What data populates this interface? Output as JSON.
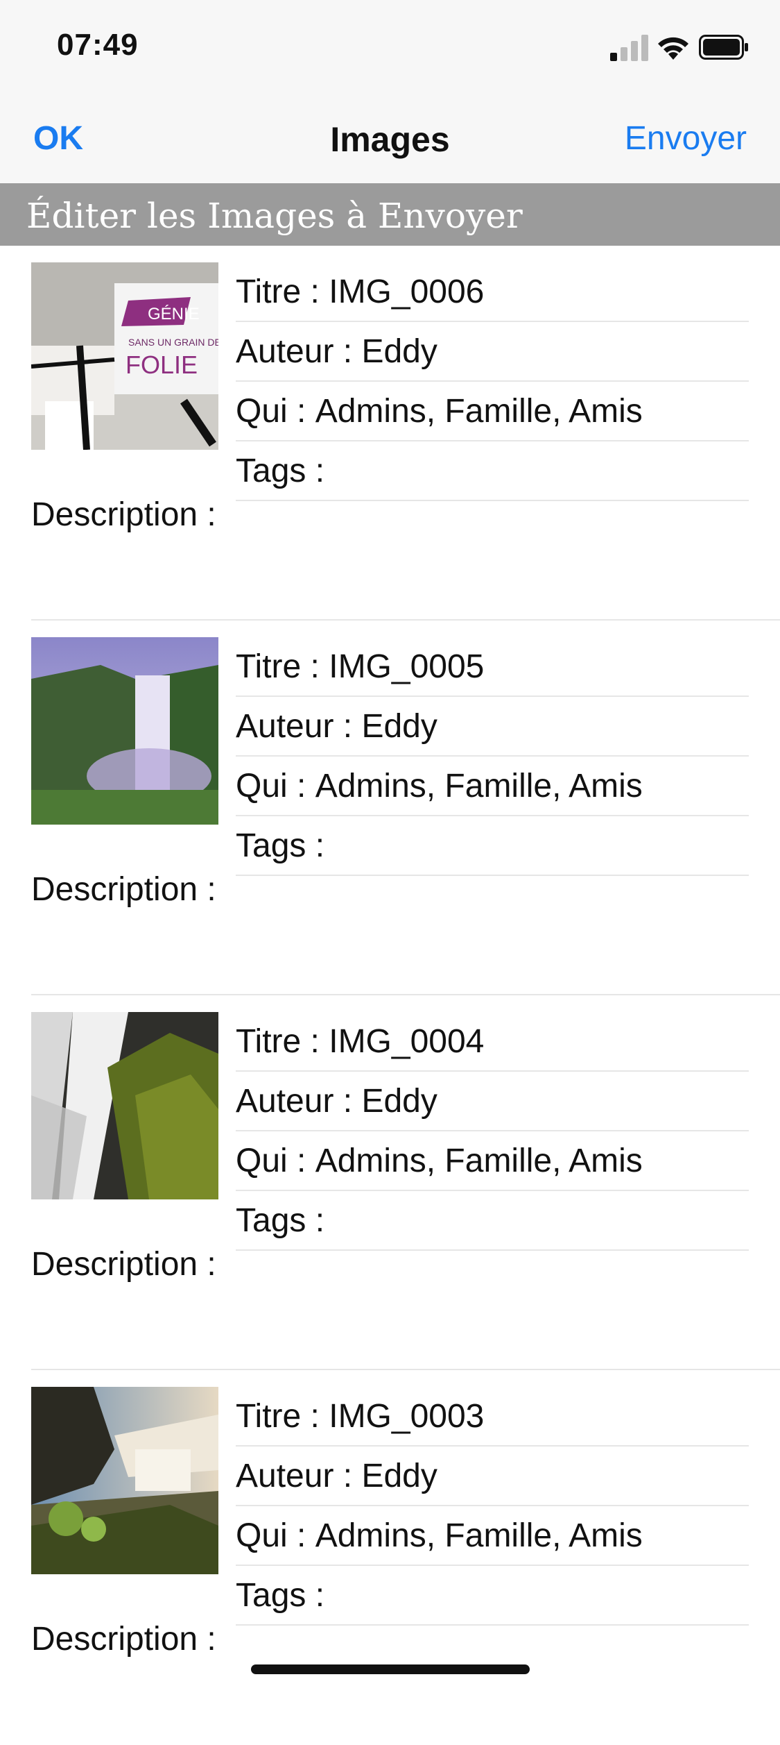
{
  "status_bar": {
    "time": "07:49"
  },
  "nav": {
    "left_button": "OK",
    "title": "Images",
    "right_button": "Envoyer"
  },
  "section": {
    "title": "Éditer les Images à Envoyer"
  },
  "labels": {
    "title": "Titre : ",
    "author": "Auteur : ",
    "who": "Qui : ",
    "tags": "Tags : ",
    "description": "Description :"
  },
  "items": [
    {
      "title": "IMG_0006",
      "author": "Eddy",
      "who": "Admins, Famille, Amis",
      "tags": "",
      "description": ""
    },
    {
      "title": "IMG_0005",
      "author": "Eddy",
      "who": "Admins, Famille, Amis",
      "tags": "",
      "description": ""
    },
    {
      "title": "IMG_0004",
      "author": "Eddy",
      "who": "Admins, Famille, Amis",
      "tags": "",
      "description": ""
    },
    {
      "title": "IMG_0003",
      "author": "Eddy",
      "who": "Admins, Famille, Amis",
      "tags": "",
      "description": ""
    }
  ]
}
